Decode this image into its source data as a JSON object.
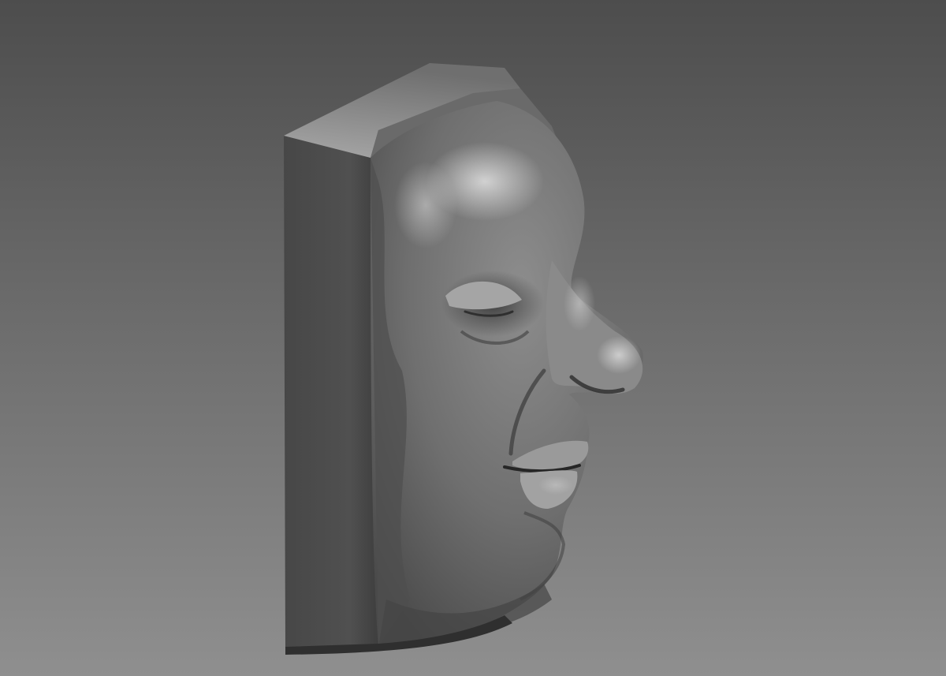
{
  "scene": {
    "subject": "sculpted-face-relief-on-block",
    "view": "three-quarter-profile-facing-right",
    "material": "matte-grey-clay"
  },
  "colors": {
    "background_top": "#4d4d4d",
    "background_bottom": "#8f8f8f",
    "block_side": "#4a4a4a",
    "block_top": "#8a8a8a",
    "face_base": "#6e6e6e",
    "face_highlight": "#c9c9c9",
    "face_shadow": "#3a3a3a"
  }
}
